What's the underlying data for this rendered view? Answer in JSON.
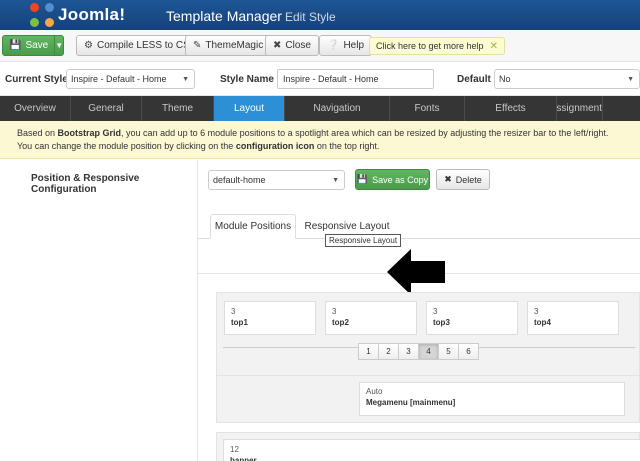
{
  "header": {
    "brand": "Joomla!",
    "title": "Template Manager",
    "subtitle": "Edit Style"
  },
  "toolbar": {
    "save": "Save",
    "compile": "Compile LESS to CSS",
    "thememagic": "ThemeMagic",
    "close": "Close",
    "help": "Help",
    "hint": "Click here to get more help"
  },
  "style_row": {
    "current_label": "Current Style",
    "current_value": "Inspire - Default - Home",
    "name_label": "Style Name *",
    "name_value": "Inspire - Default - Home",
    "default_label": "Default",
    "default_value": "No"
  },
  "tabs": [
    "Overview",
    "General",
    "Theme",
    "Layout",
    "Navigation",
    "Fonts",
    "Effects",
    "Assignment"
  ],
  "active_tab": "Layout",
  "info": {
    "line1_a": "Based on ",
    "line1_b": "Bootstrap Grid",
    "line1_c": ", you can add up to 6 module positions to a spotlight area which can be resized by adjusting the resizer bar to the left/right.",
    "line2_a": "You can change the module position by clicking on the ",
    "line2_b": "configuration icon",
    "line2_c": " on the top right."
  },
  "config": {
    "label": "Position & Responsive Configuration",
    "layout_value": "default-home",
    "save_copy": "Save as Copy",
    "delete": "Delete"
  },
  "subtabs": {
    "module_positions": "Module Positions",
    "responsive_layout": "Responsive Layout",
    "tooltip": "Responsive Layout"
  },
  "modules": [
    {
      "size": "3",
      "name": "top1"
    },
    {
      "size": "3",
      "name": "top2"
    },
    {
      "size": "3",
      "name": "top3"
    },
    {
      "size": "3",
      "name": "top4"
    }
  ],
  "pager": [
    "1",
    "2",
    "3",
    "4",
    "5",
    "6"
  ],
  "pager_active": "4",
  "megamenu": {
    "size": "Auto",
    "name": "Megamenu [mainmenu]"
  },
  "banner": {
    "size": "12",
    "name": "banner"
  },
  "colors": {
    "header": "#1e5696",
    "tabs": "#353535",
    "active_tab": "#2d8fd5",
    "success": "#4a9b4a",
    "info_bg": "#fcf8d4"
  }
}
